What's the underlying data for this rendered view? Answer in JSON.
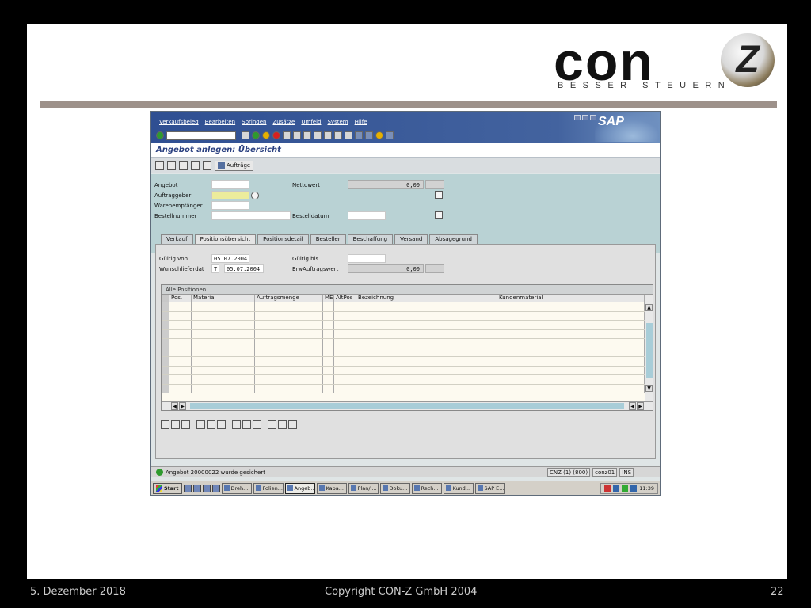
{
  "slide": {
    "logo_text": "con",
    "logo_mark": "Z",
    "logo_tagline": "BESSER STEUERN"
  },
  "sap": {
    "brand": "SAP",
    "menu": [
      "Verkaufsbeleg",
      "Bearbeiten",
      "Springen",
      "Zusätze",
      "Umfeld",
      "System",
      "Hilfe"
    ],
    "title": "Angebot anlegen: Übersicht",
    "app_toolbar": {
      "auftraege_label": "Aufträge"
    },
    "header": {
      "angebot_label": "Angebot",
      "auftraggeber_label": "Auftraggeber",
      "warenempfaenger_label": "Warenempfänger",
      "bestellnummer_label": "Bestellnummer",
      "nettowert_label": "Nettowert",
      "nettowert_value": "0,00",
      "bestelldatum_label": "Bestelldatum"
    },
    "tabs": [
      "Verkauf",
      "Positionsübersicht",
      "Positionsdetail",
      "Besteller",
      "Beschaffung",
      "Versand",
      "Absagegrund"
    ],
    "active_tab": "Positionsübersicht",
    "panel": {
      "gueltig_von_label": "Gültig von",
      "gueltig_von_value": "05.07.2004",
      "gueltig_bis_label": "Gültig bis",
      "wunschlieferdat_label": "Wunschlieferdat",
      "wunschlieferdat_type": "T",
      "wunschlieferdat_value": "05.07.2004",
      "erwauftragswert_label": "ErwAuftragswert",
      "erwauftragswert_value": "0,00"
    },
    "grid": {
      "title": "Alle Positionen",
      "columns": [
        "Pos.",
        "Material",
        "Auftragsmenge",
        "ME",
        "AltPos",
        "Bezeichnung",
        "Kundenmaterial"
      ]
    },
    "status": {
      "message": "Angebot 20000022 wurde gesichert",
      "system": "CNZ (1) (800)",
      "user": "conz01",
      "mode": "INS"
    },
    "taskbar": {
      "start": "Start",
      "tasks": [
        "Dreh...",
        "Folien...",
        "Angeb...",
        "Kapa...",
        "Plan/I...",
        "Doku...",
        "Rech...",
        "Kund...",
        "SAP E..."
      ],
      "active_task": "Angeb...",
      "clock": "11:39"
    }
  },
  "footer": {
    "date": "5. Dezember 2018",
    "copyright": "Copyright CON-Z GmbH 2004",
    "page": "22"
  }
}
